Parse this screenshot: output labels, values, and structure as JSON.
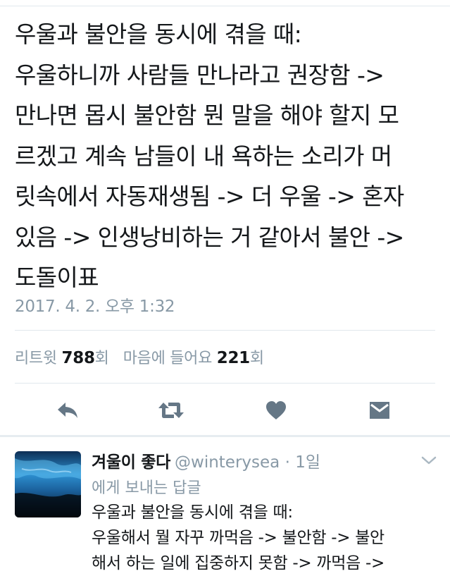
{
  "tweet": {
    "lines": [
      "우울과 불안을 동시에 겪을 때:",
      "우울하니까 사람들 만나라고 권장함 ->",
      "만나면 몹시 불안함 뭔 말을 해야 할지 모",
      "르겠고 계속 남들이 내 욕하는 소리가 머",
      "릿속에서 자동재생됨 -> 더 우울 -> 혼자",
      "있음 -> 인생낭비하는 거 같아서 불안 ->",
      "도돌이표"
    ],
    "timestamp": "2017. 4. 2. 오후 1:32"
  },
  "stats": {
    "retweet_label": "리트윗",
    "retweet_count": "788",
    "retweet_unit": "회",
    "likes_label": "마음에 들어요",
    "likes_count": "221",
    "likes_unit": "회"
  },
  "actions": {
    "icons": [
      "reply-icon",
      "retweet-icon",
      "heart-icon",
      "message-icon"
    ],
    "color": "#657786"
  },
  "reply": {
    "name": "겨울이 좋다",
    "handle": "@winterysea",
    "dot": " · ",
    "time": "1일",
    "reply_to": "에게 보내는 답글",
    "lines": [
      "우울과 불안을 동시에 겪을 때:",
      "우울해서 뭘 자꾸 까먹음 -> 불안함 -> 불안",
      "해서 하는 일에 집중하지 못함 -> 까먹음 ->"
    ]
  },
  "colors": {
    "text": "#14171a",
    "muted": "#8899a6",
    "divider": "#e1e8ed"
  }
}
